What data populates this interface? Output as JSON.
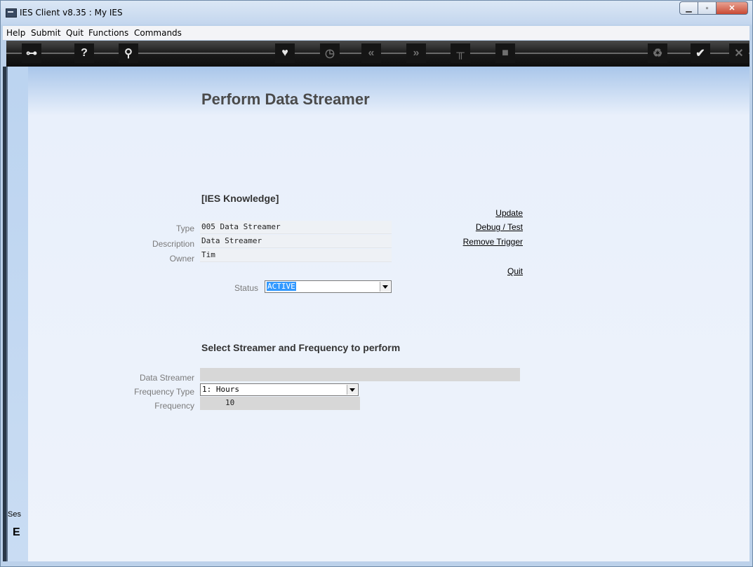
{
  "window": {
    "title": "IES Client v8.35 : My IES"
  },
  "menu": [
    "Help",
    "Submit",
    "Quit",
    "Functions",
    "Commands"
  ],
  "toolbar": [
    {
      "name": "key-icon",
      "glyph": "⊶"
    },
    {
      "name": "help-icon",
      "glyph": "?"
    },
    {
      "name": "search-icon",
      "glyph": "⚲"
    },
    {
      "name": "heart-icon",
      "glyph": "♥"
    },
    {
      "name": "clock-icon",
      "glyph": "◷"
    },
    {
      "name": "back-icon",
      "glyph": "«"
    },
    {
      "name": "forward-icon",
      "glyph": "»"
    },
    {
      "name": "tools-icon",
      "glyph": "╥"
    },
    {
      "name": "stop-icon",
      "glyph": "■"
    },
    {
      "name": "recycle-icon",
      "glyph": "♻"
    },
    {
      "name": "check-icon",
      "glyph": "✔"
    },
    {
      "name": "close-icon",
      "glyph": "✕"
    }
  ],
  "page": {
    "heading": "Perform Data Streamer",
    "section_title": "[IES Knowledge]",
    "type_label": "Type",
    "type_value": "005 Data Streamer",
    "description_label": "Description",
    "description_value": "Data Streamer",
    "owner_label": "Owner",
    "owner_value": "Tim",
    "status_label": "Status",
    "status_value": "ACTIVE",
    "links": {
      "update": "Update",
      "debug_test": "Debug / Test",
      "remove_trigger": "Remove Trigger",
      "quit": "Quit"
    },
    "streamer_section_title": "Select Streamer and Frequency to perform",
    "data_streamer_label": "Data Streamer",
    "data_streamer_value": "",
    "frequency_type_label": "Frequency Type",
    "frequency_type_value": "1: Hours",
    "frequency_label": "Frequency",
    "frequency_value": "10"
  },
  "side": {
    "session_label": "Ses",
    "session_glyph": "E"
  }
}
